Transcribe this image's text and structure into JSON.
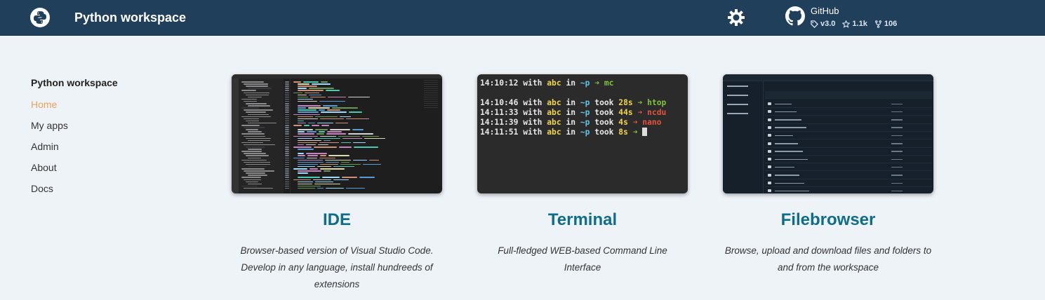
{
  "header": {
    "title": "Python workspace",
    "github": {
      "name": "GitHub",
      "version": "v3.0",
      "stars": "1.1k",
      "forks": "106"
    }
  },
  "sidebar": {
    "title": "Python workspace",
    "items": [
      {
        "label": "Home",
        "active": true
      },
      {
        "label": "My apps",
        "active": false
      },
      {
        "label": "Admin",
        "active": false
      },
      {
        "label": "About",
        "active": false
      },
      {
        "label": "Docs",
        "active": false
      }
    ]
  },
  "cards": [
    {
      "title": "IDE",
      "description": "Browser-based version of Visual Studio Code. Develop in any language, install hundreeds of extensions"
    },
    {
      "title": "Terminal",
      "description": "Full-fledged WEB-based Command Line Interface"
    },
    {
      "title": "Filebrowser",
      "description": "Browse, upload and download files and folders to and from the workspace"
    }
  ],
  "terminal": {
    "lines": [
      {
        "time": "14:10:12",
        "with": "with",
        "user": "abc",
        "in": "in",
        "dir": "~p",
        "took": "",
        "dur": "",
        "arrow": "➜",
        "arrow_color": "green",
        "cmd": "mc"
      },
      {
        "time": "14:10:46",
        "with": "with",
        "user": "abc",
        "in": "in",
        "dir": "~p",
        "took": "took",
        "dur": "28s",
        "arrow": "➜",
        "arrow_color": "green",
        "cmd": "htop"
      },
      {
        "time": "14:11:33",
        "with": "with",
        "user": "abc",
        "in": "in",
        "dir": "~p",
        "took": "took",
        "dur": "44s",
        "arrow": "➜",
        "arrow_color": "red",
        "cmd": "ncdu"
      },
      {
        "time": "14:11:39",
        "with": "with",
        "user": "abc",
        "in": "in",
        "dir": "~p",
        "took": "took",
        "dur": "4s",
        "arrow": "➜",
        "arrow_color": "red",
        "cmd": "nano"
      },
      {
        "time": "14:11:51",
        "with": "with",
        "user": "abc",
        "in": "in",
        "dir": "~p",
        "took": "took",
        "dur": "8s",
        "arrow": "➜",
        "arrow_color": "green",
        "cmd": ""
      }
    ]
  },
  "colors": {
    "header_bg": "#1f3f5b",
    "accent": "#0f6d8c",
    "active_nav": "#e9a35c",
    "page_bg": "#eef3f8"
  }
}
